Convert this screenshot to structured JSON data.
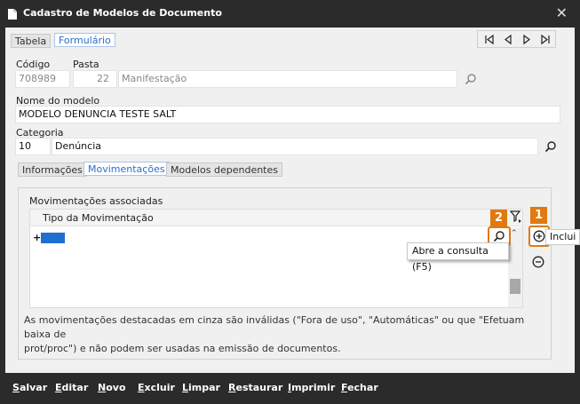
{
  "window": {
    "title": "Cadastro de Modelos de Documento"
  },
  "tabs": {
    "tabela": "Tabela",
    "formulario": "Formulário"
  },
  "fields": {
    "codigo_label": "Código",
    "codigo_value": "708989",
    "pasta_label": "Pasta",
    "pasta_number": "22",
    "pasta_name": "Manifestação",
    "nome_label": "Nome do modelo",
    "nome_value": "MODELO DENUNCIA TESTE SALT",
    "categoria_label": "Categoria",
    "categoria_number": "10",
    "categoria_name": "Denúncia"
  },
  "subtabs": {
    "informacoes": "Informações",
    "movimentacoes": "Movimentações",
    "modelos_dependentes": "Modelos dependentes"
  },
  "panel": {
    "title": "Movimentações associadas",
    "column_header": "Tipo da Movimentação",
    "row_marker": "+",
    "note_line1": "As movimentações destacadas em cinza são inválidas (\"Fora de uso\", \"Automáticas\" ou que \"Efetuam baixa de",
    "note_line2": "prot/proc\") e não podem ser usadas na emissão de documentos."
  },
  "annotations": {
    "badge_1": "1",
    "badge_2": "2"
  },
  "tooltips": {
    "consulta": "Abre a consulta (F5)",
    "inclui": "Inclui r"
  },
  "toolbar": {
    "salvar_u": "S",
    "salvar_rest": "alvar",
    "editar_u": "E",
    "editar_rest": "ditar",
    "novo_u": "N",
    "novo_rest": "ovo",
    "excluir_u": "E",
    "excluir_rest": "xcluir",
    "limpar_u": "L",
    "limpar_rest": "impar",
    "restaurar_u": "R",
    "restaurar_rest": "estaurar",
    "imprimir_u": "I",
    "imprimir_rest": "mprimir",
    "fechar_u": "F",
    "fechar_rest": "echar"
  },
  "colors": {
    "accent": "#2a6fc9",
    "selection": "#1f6fd0",
    "annotation": "#e07a10",
    "chrome": "#2b2b2b"
  },
  "icons": [
    "app-icon",
    "close-icon",
    "search-icon",
    "first-record-icon",
    "previous-record-icon",
    "next-record-icon",
    "last-record-icon",
    "filter-icon",
    "add-circle-icon",
    "remove-circle-icon"
  ]
}
